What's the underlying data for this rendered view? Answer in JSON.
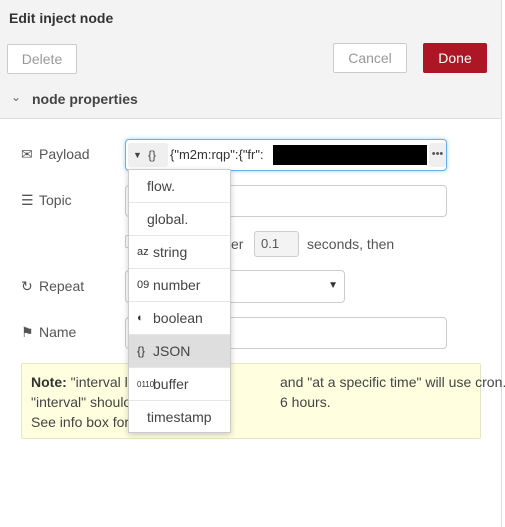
{
  "header": {
    "title": "Edit inject node"
  },
  "toolbar": {
    "delete_label": "Delete",
    "cancel_label": "Cancel",
    "done_label": "Done"
  },
  "section": {
    "label": "node properties"
  },
  "fields": {
    "payload": {
      "label": "Payload",
      "type_glyph": "{}",
      "value": "{\"m2m:rqp\":{\"fr\":"
    },
    "topic": {
      "label": "Topic",
      "value": ""
    },
    "inject_once": {
      "suffix": "er",
      "seconds_value": "0.1",
      "after_text": "seconds, then"
    },
    "repeat": {
      "label": "Repeat",
      "value": ""
    },
    "name": {
      "label": "Name",
      "value": ""
    }
  },
  "note": {
    "line1_bold": "Note:",
    "line1a": "\"interval l",
    "line1b": "and \"at a specific time\" will use cron.",
    "line2a": "\"interval\" shoulo",
    "line2b": "6 hours.",
    "line3a": "See info box for"
  },
  "type_menu": {
    "items": [
      {
        "label": "flow.",
        "icon": ""
      },
      {
        "label": "global.",
        "icon": ""
      },
      {
        "label": "string",
        "icon": "az"
      },
      {
        "label": "number",
        "icon": "09"
      },
      {
        "label": "boolean",
        "icon": "◐"
      },
      {
        "label": "JSON",
        "icon": "{}"
      },
      {
        "label": "buffer",
        "icon": "0110"
      },
      {
        "label": "timestamp",
        "icon": ""
      }
    ],
    "selected": "JSON"
  },
  "colors": {
    "accent": "#ad1625",
    "focus": "#66afe9",
    "note_bg": "#ffffe0"
  }
}
